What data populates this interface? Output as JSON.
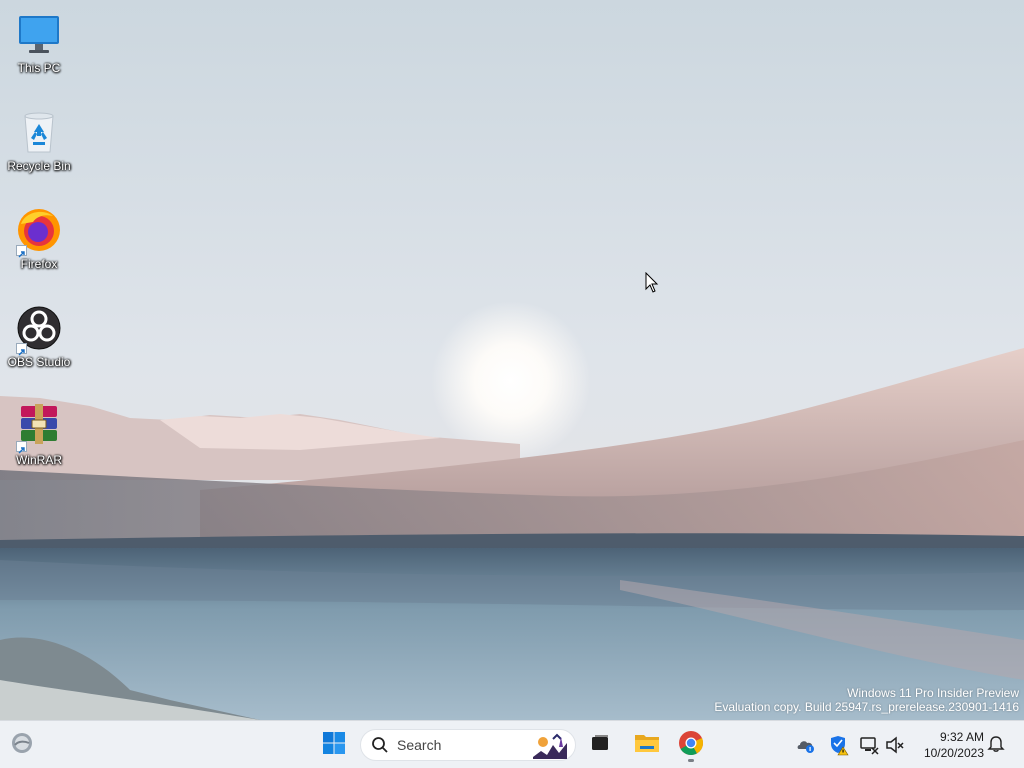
{
  "desktop": {
    "icons": [
      {
        "label": "This PC"
      },
      {
        "label": "Recycle Bin"
      },
      {
        "label": "Firefox"
      },
      {
        "label": "OBS Studio"
      },
      {
        "label": "WinRAR"
      }
    ]
  },
  "watermark": {
    "line1": "Windows 11 Pro Insider Preview",
    "line2": "Evaluation copy. Build 25947.rs_prerelease.230901-1416"
  },
  "taskbar": {
    "search_placeholder": "Search",
    "apps": [
      "start-icon",
      "search",
      "task-view-icon",
      "file-explorer-icon",
      "chrome-icon"
    ],
    "clock": {
      "time": "9:32 AM",
      "date": "10/20/2023"
    },
    "tray": [
      "onedrive-icon",
      "defender-warning-icon",
      "network-disconnected-icon",
      "volume-muted-icon",
      "notification-bell-icon"
    ]
  },
  "colors": {
    "accent": "#0078d4",
    "taskbar_bg": "#eef1f5"
  }
}
